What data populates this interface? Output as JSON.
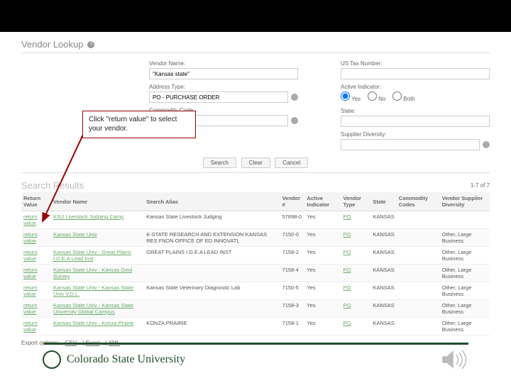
{
  "page": {
    "title": "Vendor Lookup"
  },
  "callout": {
    "text": "Click \"return value\" to select your vendor."
  },
  "form": {
    "vendorName": {
      "label": "Vendor Name:",
      "value": "\"Kansas state\""
    },
    "addressType": {
      "label": "Address Type:",
      "value": "PO - PURCHASE ORDER"
    },
    "commodityCode": {
      "label": "Commodity Code:"
    },
    "usTax": {
      "label": "US Tax Number:"
    },
    "activeIndicator": {
      "label": "Active Indicator:",
      "options": [
        "Yes",
        "No",
        "Both"
      ],
      "selected": "Yes"
    },
    "state": {
      "label": "State:"
    },
    "supplierDiversity": {
      "label": "Supplier Diversity:"
    }
  },
  "buttons": {
    "search": "Search",
    "clear": "Clear",
    "cancel": "Cancel"
  },
  "results": {
    "title": "Search Results",
    "count_label": "1-7 of 7",
    "export_label": "Export options:",
    "exports": [
      "CSV",
      "Excel",
      "XML"
    ],
    "columns": [
      "Return Value",
      "Vendor Name",
      "Search Alias",
      "Vendor #",
      "Active Indicator",
      "Vendor Type",
      "State",
      "Commodity Codes",
      "Vendor Supplier Diversity"
    ],
    "rows": [
      {
        "rv": "return value",
        "name": "KSU Livestock Judging Camp",
        "alias": "Kansas State Livestock Judging",
        "vnum": "57898-0",
        "ai": "Yes",
        "vt": "PO",
        "st": "KANSAS",
        "cc": "",
        "sd": ""
      },
      {
        "rv": "return value",
        "name": "Kansas State Univ",
        "alias": "K-STATE RESEARCH AND EXTENSION KANSAS RES FNDN OFFICE OF ED INNOVATL",
        "vnum": "7150-0",
        "ai": "Yes",
        "vt": "PO",
        "st": "KANSAS",
        "cc": "",
        "sd": "Other, Large Business"
      },
      {
        "rv": "return value",
        "name": "Kansas State Univ - Great Plains I.D.E.A Lead Inst",
        "alias": "GREAT PLAINS I.D.E.A LEAD INST",
        "vnum": "7158-2",
        "ai": "Yes",
        "vt": "PO",
        "st": "KANSAS",
        "cc": "",
        "sd": "Other, Large Business"
      },
      {
        "rv": "return value",
        "name": "Kansas State Univ - Kansas Geol Survey",
        "alias": "",
        "vnum": "7158-4",
        "ai": "Yes",
        "vt": "PO",
        "st": "KANSAS",
        "cc": "",
        "sd": "Other, Large Business"
      },
      {
        "rv": "return value",
        "name": "Kansas State Univ - Kansas State Univ V.D.L.",
        "alias": "Kansas State Veterinary Diagnostic Lab",
        "vnum": "7150-5",
        "ai": "Yes",
        "vt": "PO",
        "st": "KANSAS",
        "cc": "",
        "sd": "Other, Large Business"
      },
      {
        "rv": "return value",
        "name": "Kansas State Univ - Kansas State University Global Campus",
        "alias": "",
        "vnum": "7158-3",
        "ai": "Yes",
        "vt": "PO",
        "st": "KANSAS",
        "cc": "",
        "sd": "Other, Large Business"
      },
      {
        "rv": "return value",
        "name": "Kansas State Univ - Konza Prairie",
        "alias": "KONZA PRAIRIE",
        "vnum": "7158-1",
        "ai": "Yes",
        "vt": "PO",
        "st": "KANSAS",
        "cc": "",
        "sd": "Other, Large Business"
      }
    ]
  },
  "footer": {
    "org": "Colorado State University"
  }
}
